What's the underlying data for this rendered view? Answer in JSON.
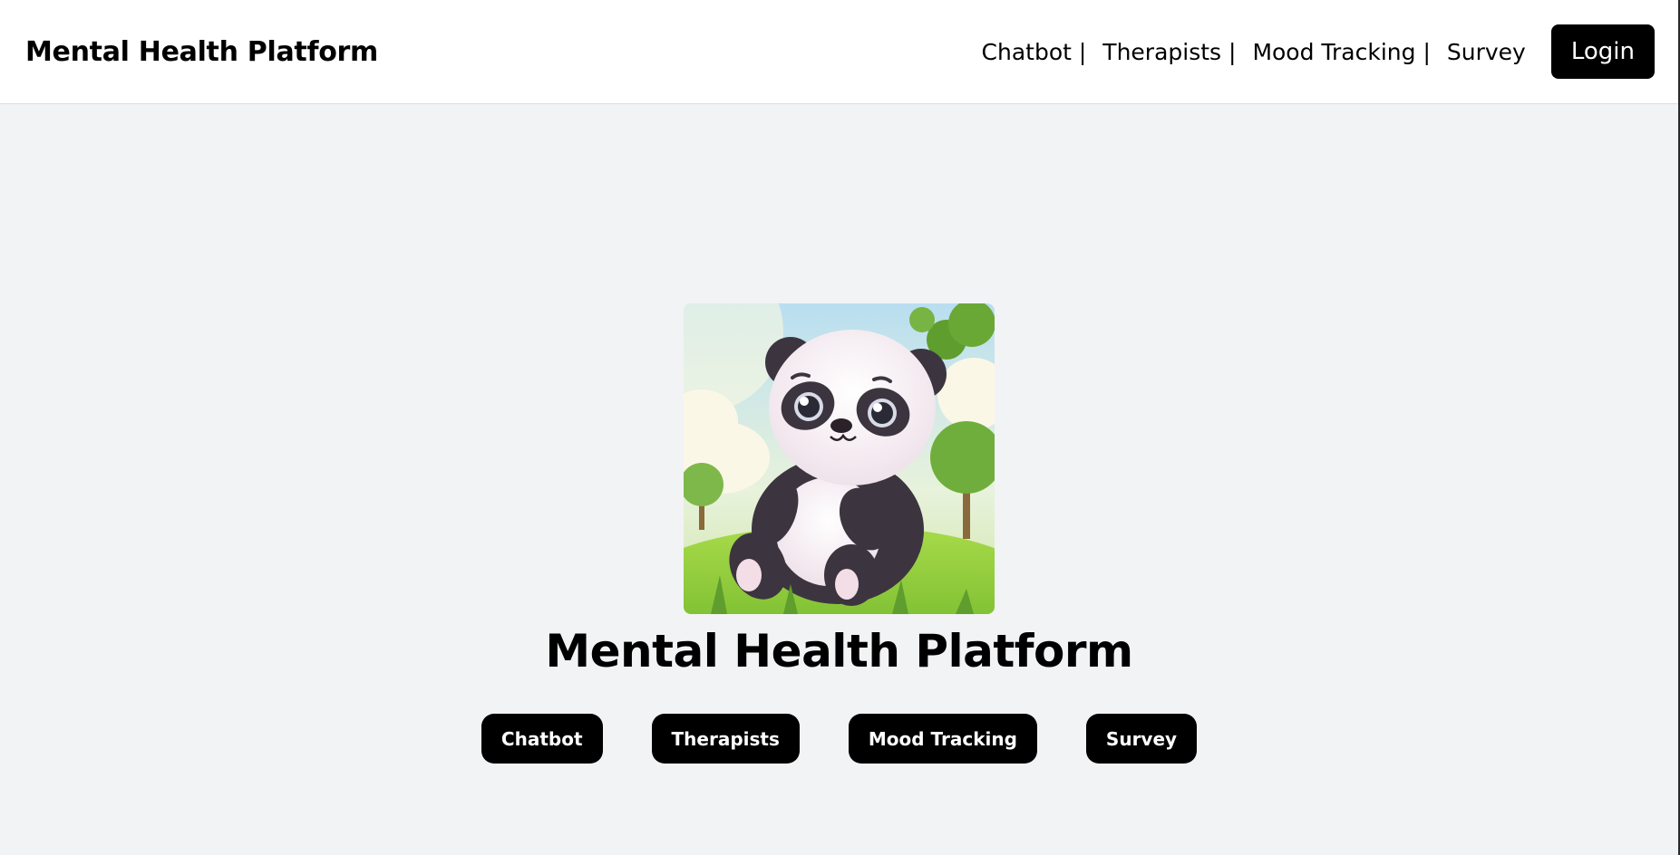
{
  "header": {
    "brand": "Mental Health Platform",
    "nav": [
      {
        "label": "Chatbot |",
        "name": "nav-chatbot"
      },
      {
        "label": "Therapists |",
        "name": "nav-therapists"
      },
      {
        "label": "Mood Tracking |",
        "name": "nav-mood-tracking"
      },
      {
        "label": "Survey",
        "name": "nav-survey"
      }
    ],
    "login_label": "Login"
  },
  "hero": {
    "image_icon": "panda-illustration",
    "title": "Mental Health Platform",
    "buttons": [
      {
        "label": "Chatbot"
      },
      {
        "label": "Therapists"
      },
      {
        "label": "Mood Tracking"
      },
      {
        "label": "Survey"
      }
    ]
  },
  "colors": {
    "page_bg": "#f2f3f5",
    "header_bg": "#ffffff",
    "button_bg": "#000000",
    "button_text": "#ffffff"
  }
}
